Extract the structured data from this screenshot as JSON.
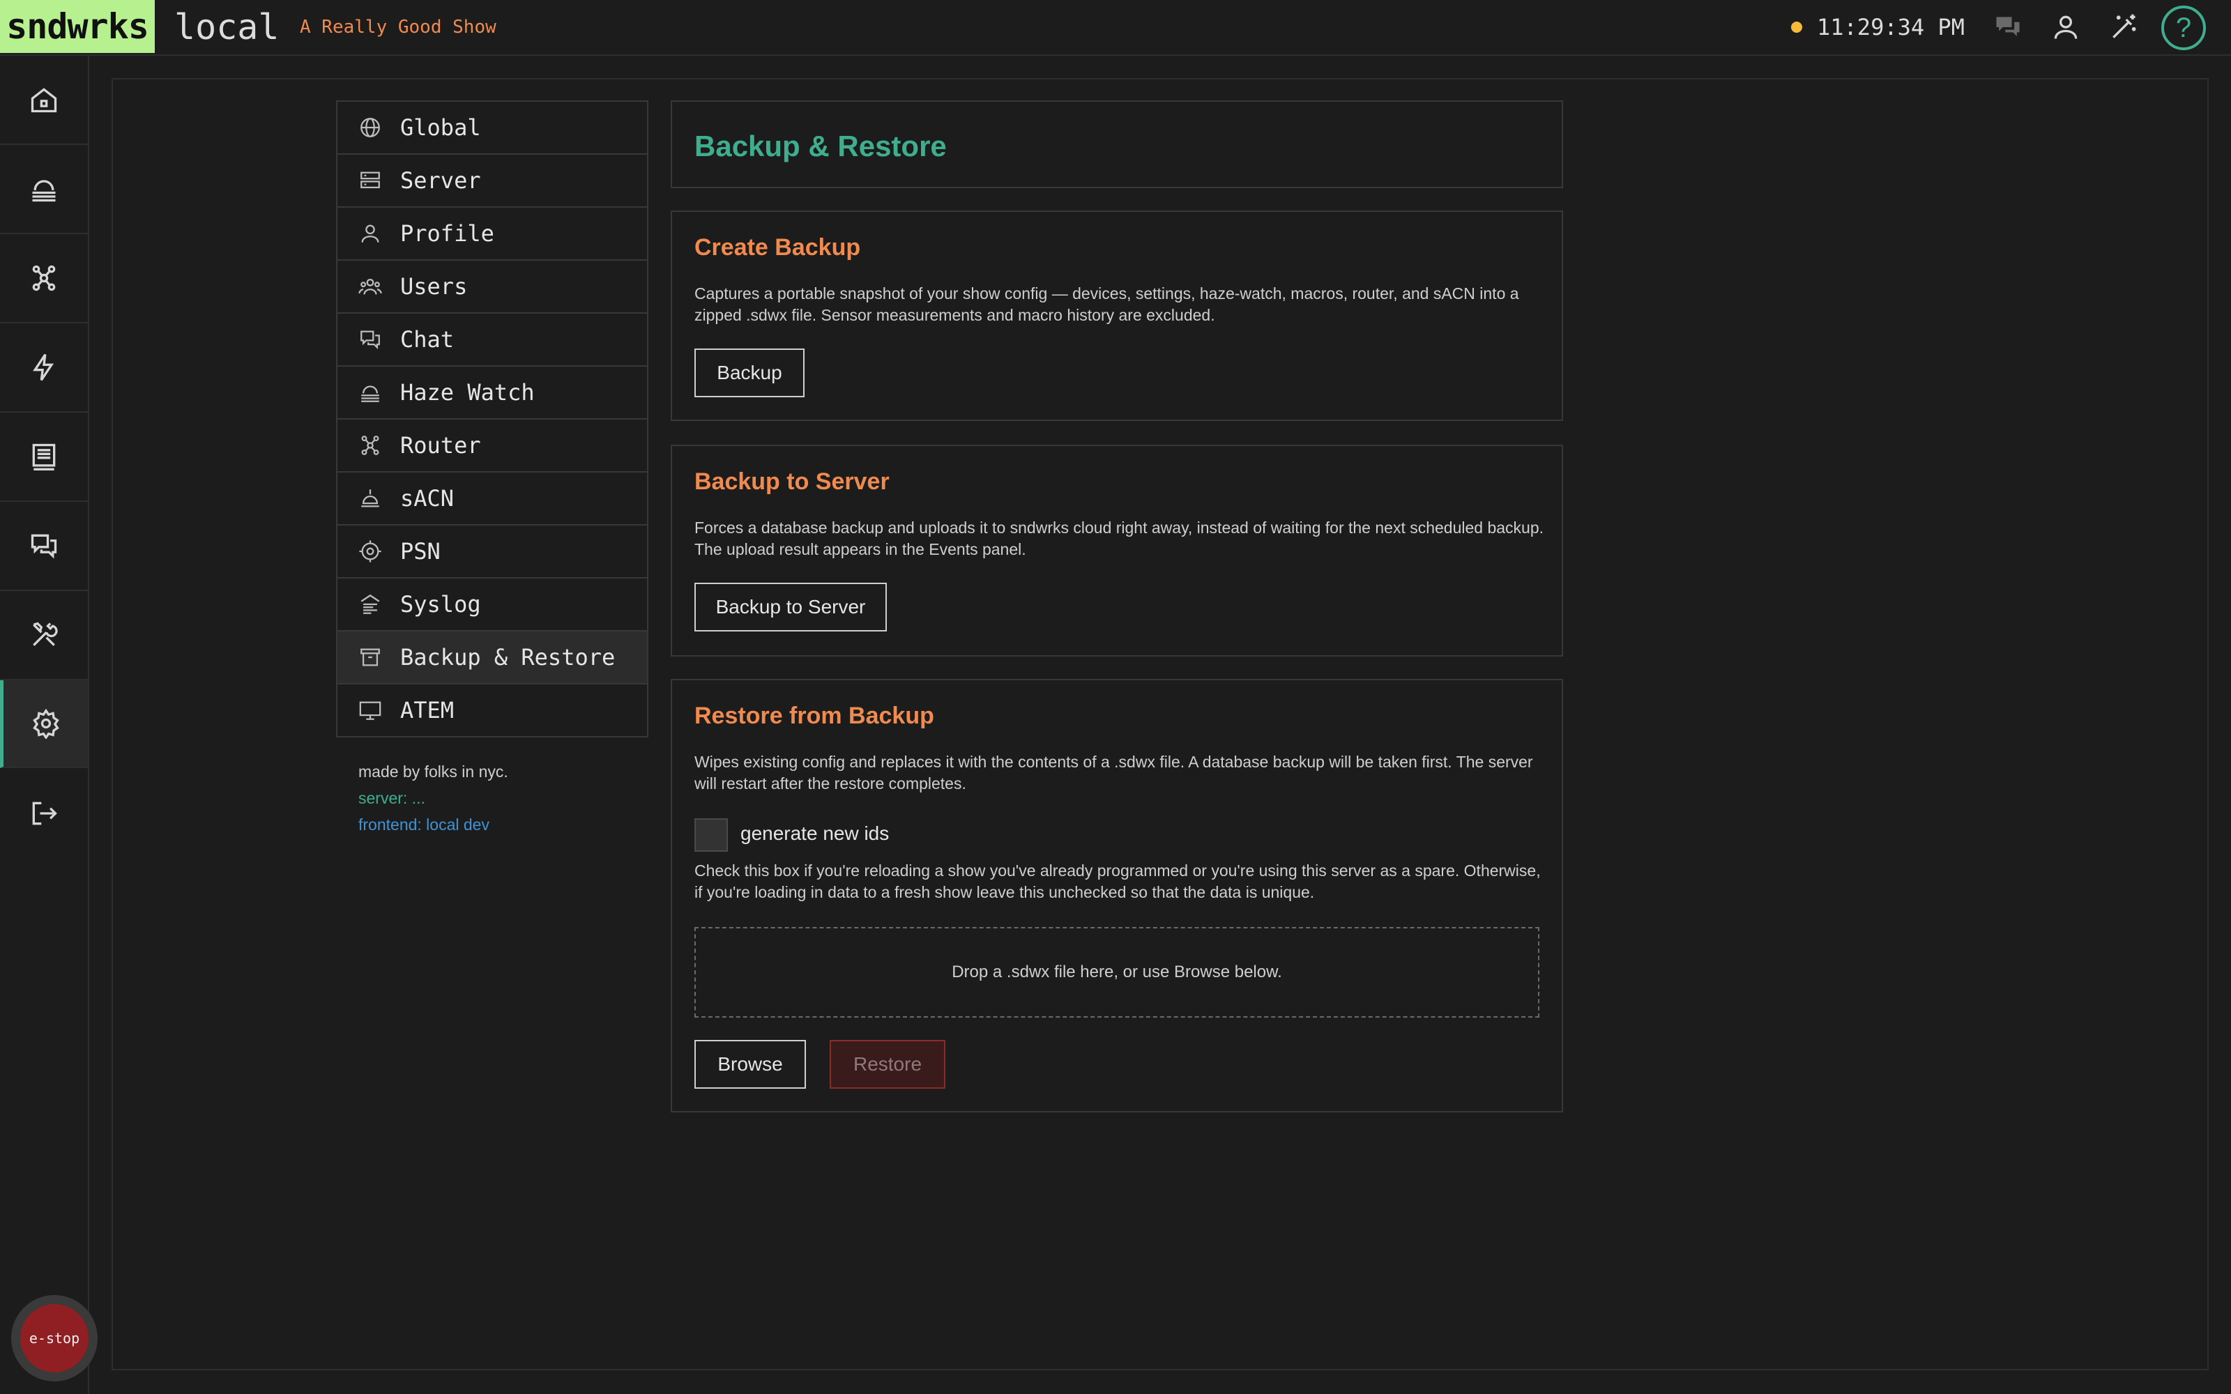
{
  "header": {
    "logo": "sndwrks",
    "env": "local",
    "show": "A Really Good Show",
    "clock": "11:29:34 PM",
    "help": "?",
    "icons": [
      "chat-icon",
      "user-icon",
      "magic-wand-icon",
      "help-icon"
    ],
    "status_color": "#f7b93a"
  },
  "rail": {
    "items": [
      "home-icon",
      "haze-icon",
      "router-icon",
      "lightning-icon",
      "macro-icon",
      "chat-icon",
      "tools-icon",
      "settings-icon",
      "logout-icon"
    ],
    "active": "settings-icon",
    "estop": "e-stop"
  },
  "settings_nav": {
    "items": [
      {
        "label": "Global",
        "icon": "globe-icon"
      },
      {
        "label": "Server",
        "icon": "server-icon"
      },
      {
        "label": "Profile",
        "icon": "user-icon"
      },
      {
        "label": "Users",
        "icon": "users-icon"
      },
      {
        "label": "Chat",
        "icon": "chat-icon"
      },
      {
        "label": "Haze Watch",
        "icon": "haze-icon"
      },
      {
        "label": "Router",
        "icon": "router-icon"
      },
      {
        "label": "sACN",
        "icon": "lamp-icon"
      },
      {
        "label": "PSN",
        "icon": "target-icon"
      },
      {
        "label": "Syslog",
        "icon": "log-icon"
      },
      {
        "label": "Backup & Restore",
        "icon": "archive-icon"
      },
      {
        "label": "ATEM",
        "icon": "monitor-icon"
      }
    ],
    "active": "Backup & Restore"
  },
  "credits": {
    "made_by": "made by folks in nyc.",
    "server": "server: ...",
    "frontend": "frontend: local dev"
  },
  "page": {
    "title": "Backup & Restore"
  },
  "create_backup": {
    "title": "Create Backup",
    "description": "Captures a portable snapshot of your show config — devices, settings, haze-watch, macros, router, and sACN into a zipped .sdwx file. Sensor measurements and macro history are excluded.",
    "button": "Backup"
  },
  "backup_server": {
    "title": "Backup to Server",
    "description": "Forces a database backup and uploads it to sndwrks cloud right away, instead of waiting for the next scheduled backup. The upload result appears in the Events panel.",
    "button": "Backup to Server"
  },
  "restore": {
    "title": "Restore from Backup",
    "description": "Wipes existing config and replaces it with the contents of a .sdwx file. A database backup will be taken first. The server will restart after the restore completes.",
    "checkbox_label": "generate new ids",
    "checkbox_checked": false,
    "hint": "Check this box if you're reloading a show you've already programmed or you're using this server as a spare. Otherwise, if you're loading in data to a fresh show leave this unchecked so that the data is unique.",
    "dropzone": "Drop a .sdwx file here, or use Browse below.",
    "browse_button": "Browse",
    "restore_button": "Restore"
  },
  "colors": {
    "accent": "#3fae8f",
    "section_title": "#f08a4f",
    "logo_bg": "#b7f08f",
    "estop": "#8f1f22"
  }
}
